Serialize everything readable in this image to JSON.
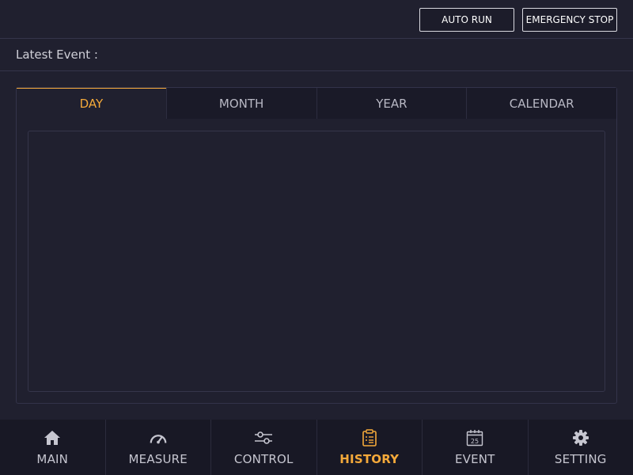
{
  "topbar": {
    "auto_run_label": "AUTO RUN",
    "emergency_stop_label": "EMERGENCY STOP"
  },
  "event": {
    "label": "Latest Event :"
  },
  "tabs": [
    {
      "label": "DAY",
      "active": true
    },
    {
      "label": "MONTH",
      "active": false
    },
    {
      "label": "YEAR",
      "active": false
    },
    {
      "label": "CALENDAR",
      "active": false
    }
  ],
  "nav": [
    {
      "label": "MAIN",
      "icon": "home-icon",
      "active": false
    },
    {
      "label": "MEASURE",
      "icon": "gauge-icon",
      "active": false
    },
    {
      "label": "CONTROL",
      "icon": "sliders-icon",
      "active": false
    },
    {
      "label": "HISTORY",
      "icon": "clipboard-list-icon",
      "active": true
    },
    {
      "label": "EVENT",
      "icon": "calendar-icon",
      "active": false,
      "icon_text": "25"
    },
    {
      "label": "SETTING",
      "icon": "gear-icon",
      "active": false
    }
  ],
  "colors": {
    "accent": "#f4a93a",
    "background": "#20202f",
    "nav_background": "#181825"
  }
}
